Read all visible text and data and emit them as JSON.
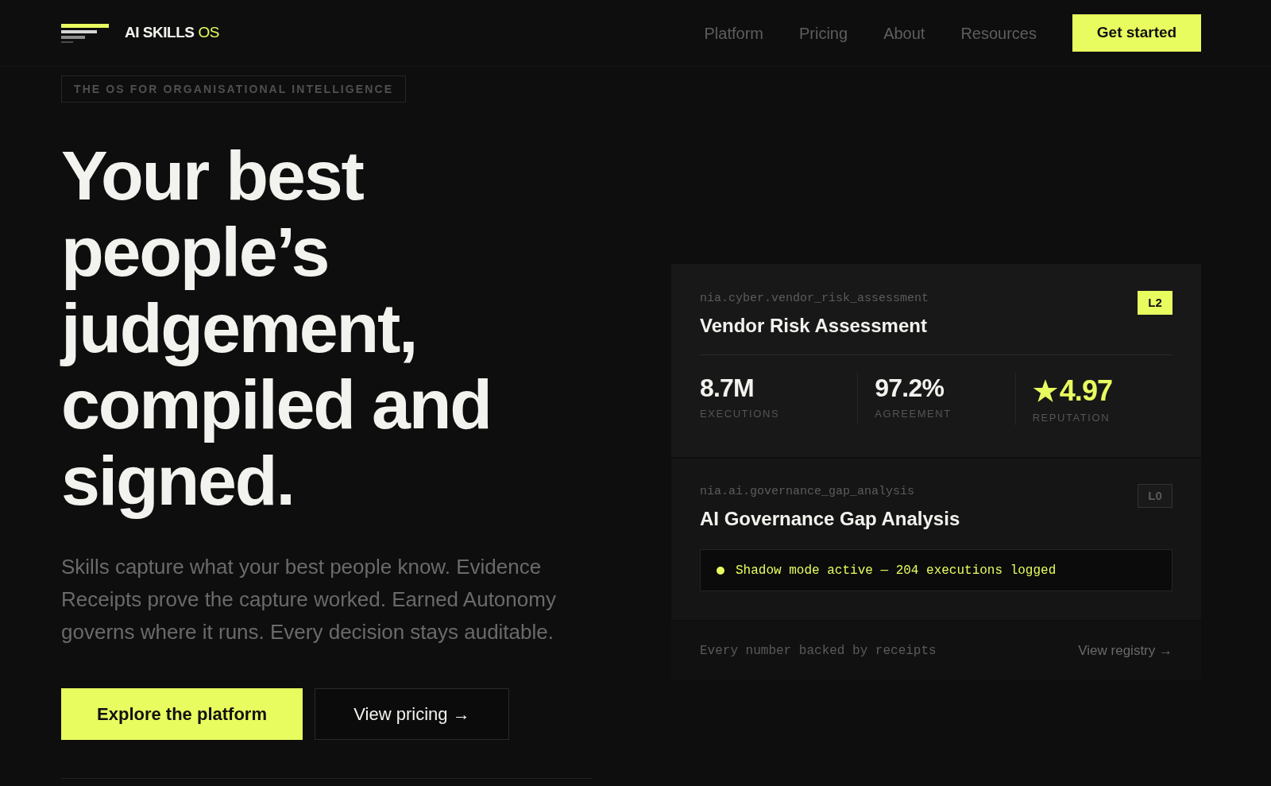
{
  "header": {
    "brand": {
      "name": "AI SKILLS",
      "suffix": "OS"
    },
    "nav": [
      "Platform",
      "Pricing",
      "About",
      "Resources"
    ],
    "cta": "Get started"
  },
  "hero": {
    "eyebrow": "THE OS FOR ORGANISATIONAL INTELLIGENCE",
    "heading": "Your best people’s judgement, compiled and signed.",
    "body": "Skills capture what your best people know. Evidence Receipts prove the capture worked. Earned Autonomy governs where it runs. Every decision stays auditable.",
    "buttons": [
      {
        "label": "Explore the platform",
        "kind": "primary"
      },
      {
        "label": "View pricing →",
        "kind": "secondary"
      }
    ]
  },
  "skills": [
    {
      "kind": "stats",
      "id": "nia.cyber.vendor_risk_assessment",
      "title": "Vendor Risk Assessment",
      "tier": "L2",
      "tier_highlighted": true,
      "stats": [
        {
          "kind": "count",
          "value": "8.7M",
          "label": "EXECUTIONS"
        },
        {
          "kind": "count",
          "value": "97.2%",
          "label": "AGREEMENT"
        },
        {
          "kind": "rating",
          "value": "4.97",
          "label": "REPUTATION"
        }
      ]
    },
    {
      "kind": "status",
      "id": "nia.ai.governance_gap_analysis",
      "title": "AI Governance Gap Analysis",
      "tier": "L0",
      "tier_highlighted": false,
      "status": "Shadow mode active — 204 executions logged"
    }
  ],
  "registry_footer": {
    "note": "Every number backed by receipts",
    "link": "View registry →"
  }
}
